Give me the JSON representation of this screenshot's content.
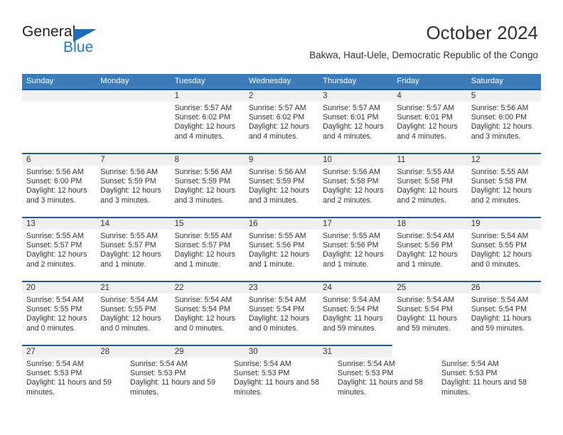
{
  "brand": {
    "name_top": "General",
    "name_bottom": "Blue",
    "triangle_color": "#1f6eb5",
    "blue_color": "#1f7bc1"
  },
  "header": {
    "title": "October 2024",
    "subtitle": "Bakwa, Haut-Uele, Democratic Republic of the Congo"
  },
  "theme": {
    "header_blue": "#3c7cba",
    "rule_blue": "#1f5c9e",
    "band_gray": "#f0f0f0",
    "text": "#333333"
  },
  "calendar": {
    "weekday_headers": [
      "Sunday",
      "Monday",
      "Tuesday",
      "Wednesday",
      "Thursday",
      "Friday",
      "Saturday"
    ],
    "weeks": [
      {
        "full_width": true,
        "days": [
          {
            "num": "",
            "lines": []
          },
          {
            "num": "",
            "lines": []
          },
          {
            "num": "1",
            "lines": [
              "Sunrise: 5:57 AM",
              "Sunset: 6:02 PM",
              "Daylight: 12 hours and 4 minutes."
            ]
          },
          {
            "num": "2",
            "lines": [
              "Sunrise: 5:57 AM",
              "Sunset: 6:02 PM",
              "Daylight: 12 hours and 4 minutes."
            ]
          },
          {
            "num": "3",
            "lines": [
              "Sunrise: 5:57 AM",
              "Sunset: 6:01 PM",
              "Daylight: 12 hours and 4 minutes."
            ]
          },
          {
            "num": "4",
            "lines": [
              "Sunrise: 5:57 AM",
              "Sunset: 6:01 PM",
              "Daylight: 12 hours and 4 minutes."
            ]
          },
          {
            "num": "5",
            "lines": [
              "Sunrise: 5:56 AM",
              "Sunset: 6:00 PM",
              "Daylight: 12 hours and 3 minutes."
            ]
          }
        ]
      },
      {
        "full_width": true,
        "days": [
          {
            "num": "6",
            "lines": [
              "Sunrise: 5:56 AM",
              "Sunset: 6:00 PM",
              "Daylight: 12 hours and 3 minutes."
            ]
          },
          {
            "num": "7",
            "lines": [
              "Sunrise: 5:56 AM",
              "Sunset: 5:59 PM",
              "Daylight: 12 hours and 3 minutes."
            ]
          },
          {
            "num": "8",
            "lines": [
              "Sunrise: 5:56 AM",
              "Sunset: 5:59 PM",
              "Daylight: 12 hours and 3 minutes."
            ]
          },
          {
            "num": "9",
            "lines": [
              "Sunrise: 5:56 AM",
              "Sunset: 5:59 PM",
              "Daylight: 12 hours and 3 minutes."
            ]
          },
          {
            "num": "10",
            "lines": [
              "Sunrise: 5:56 AM",
              "Sunset: 5:58 PM",
              "Daylight: 12 hours and 2 minutes."
            ]
          },
          {
            "num": "11",
            "lines": [
              "Sunrise: 5:55 AM",
              "Sunset: 5:58 PM",
              "Daylight: 12 hours and 2 minutes."
            ]
          },
          {
            "num": "12",
            "lines": [
              "Sunrise: 5:55 AM",
              "Sunset: 5:58 PM",
              "Daylight: 12 hours and 2 minutes."
            ]
          }
        ]
      },
      {
        "full_width": true,
        "days": [
          {
            "num": "13",
            "lines": [
              "Sunrise: 5:55 AM",
              "Sunset: 5:57 PM",
              "Daylight: 12 hours and 2 minutes."
            ]
          },
          {
            "num": "14",
            "lines": [
              "Sunrise: 5:55 AM",
              "Sunset: 5:57 PM",
              "Daylight: 12 hours and 1 minute."
            ]
          },
          {
            "num": "15",
            "lines": [
              "Sunrise: 5:55 AM",
              "Sunset: 5:57 PM",
              "Daylight: 12 hours and 1 minute."
            ]
          },
          {
            "num": "16",
            "lines": [
              "Sunrise: 5:55 AM",
              "Sunset: 5:56 PM",
              "Daylight: 12 hours and 1 minute."
            ]
          },
          {
            "num": "17",
            "lines": [
              "Sunrise: 5:55 AM",
              "Sunset: 5:56 PM",
              "Daylight: 12 hours and 1 minute."
            ]
          },
          {
            "num": "18",
            "lines": [
              "Sunrise: 5:54 AM",
              "Sunset: 5:56 PM",
              "Daylight: 12 hours and 1 minute."
            ]
          },
          {
            "num": "19",
            "lines": [
              "Sunrise: 5:54 AM",
              "Sunset: 5:55 PM",
              "Daylight: 12 hours and 0 minutes."
            ]
          }
        ]
      },
      {
        "full_width": true,
        "days": [
          {
            "num": "20",
            "lines": [
              "Sunrise: 5:54 AM",
              "Sunset: 5:55 PM",
              "Daylight: 12 hours and 0 minutes."
            ]
          },
          {
            "num": "21",
            "lines": [
              "Sunrise: 5:54 AM",
              "Sunset: 5:55 PM",
              "Daylight: 12 hours and 0 minutes."
            ]
          },
          {
            "num": "22",
            "lines": [
              "Sunrise: 5:54 AM",
              "Sunset: 5:54 PM",
              "Daylight: 12 hours and 0 minutes."
            ]
          },
          {
            "num": "23",
            "lines": [
              "Sunrise: 5:54 AM",
              "Sunset: 5:54 PM",
              "Daylight: 12 hours and 0 minutes."
            ]
          },
          {
            "num": "24",
            "lines": [
              "Sunrise: 5:54 AM",
              "Sunset: 5:54 PM",
              "Daylight: 11 hours and 59 minutes."
            ]
          },
          {
            "num": "25",
            "lines": [
              "Sunrise: 5:54 AM",
              "Sunset: 5:54 PM",
              "Daylight: 11 hours and 59 minutes."
            ]
          },
          {
            "num": "26",
            "lines": [
              "Sunrise: 5:54 AM",
              "Sunset: 5:54 PM",
              "Daylight: 11 hours and 59 minutes."
            ]
          }
        ]
      },
      {
        "full_width": false,
        "days": [
          {
            "num": "27",
            "lines": [
              "Sunrise: 5:54 AM",
              "Sunset: 5:53 PM",
              "Daylight: 11 hours and 59 minutes."
            ]
          },
          {
            "num": "28",
            "lines": [
              "Sunrise: 5:54 AM",
              "Sunset: 5:53 PM",
              "Daylight: 11 hours and 59 minutes."
            ]
          },
          {
            "num": "29",
            "lines": [
              "Sunrise: 5:54 AM",
              "Sunset: 5:53 PM",
              "Daylight: 11 hours and 58 minutes."
            ]
          },
          {
            "num": "30",
            "lines": [
              "Sunrise: 5:54 AM",
              "Sunset: 5:53 PM",
              "Daylight: 11 hours and 58 minutes."
            ]
          },
          {
            "num": "31",
            "lines": [
              "Sunrise: 5:54 AM",
              "Sunset: 5:53 PM",
              "Daylight: 11 hours and 58 minutes."
            ]
          }
        ]
      }
    ]
  }
}
